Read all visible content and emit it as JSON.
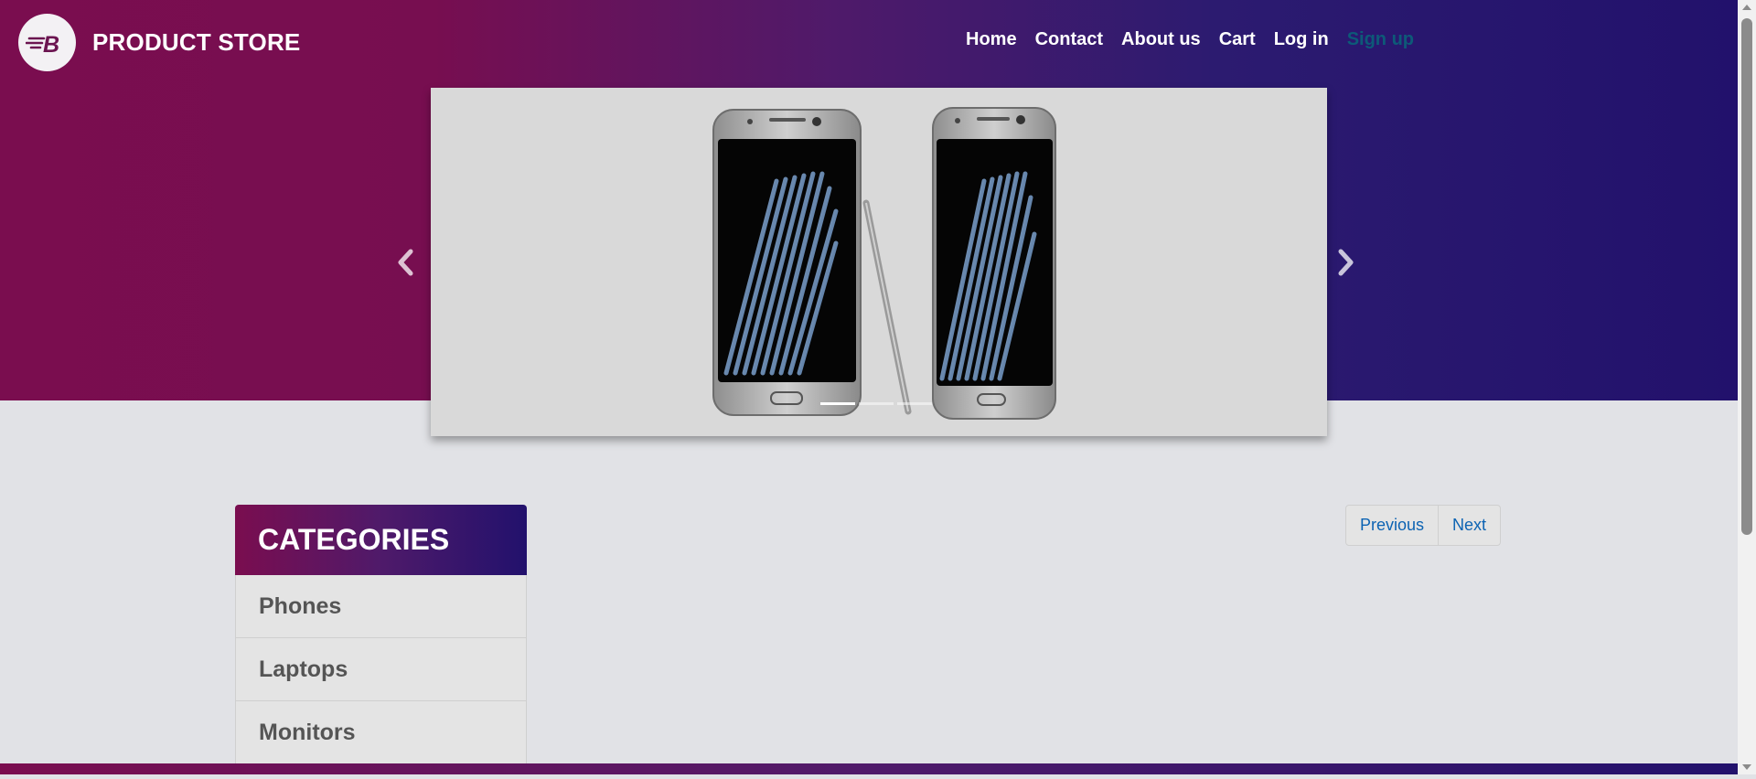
{
  "header": {
    "brand_name": "PRODUCT STORE",
    "logo_icon": "brand-logo-icon",
    "nav": [
      {
        "label": "Home"
      },
      {
        "label": "Contact"
      },
      {
        "label": "About us"
      },
      {
        "label": "Cart"
      },
      {
        "label": "Log in"
      },
      {
        "label": "Sign up"
      }
    ]
  },
  "carousel": {
    "slide_image": "samsung-galaxy-note-7-product-photo",
    "prev_icon": "chevron-left-icon",
    "next_icon": "chevron-right-icon",
    "slide_count": 3,
    "active_slide": 1
  },
  "categories": {
    "title": "CATEGORIES",
    "items": [
      {
        "label": "Phones"
      },
      {
        "label": "Laptops"
      },
      {
        "label": "Monitors"
      }
    ]
  },
  "pagination": {
    "previous_label": "Previous",
    "next_label": "Next"
  },
  "colors": {
    "brand_magenta": "#7a0d4f",
    "brand_indigo": "#22116c",
    "link_blue": "#0c63b3",
    "page_background": "#e1e2e6"
  }
}
